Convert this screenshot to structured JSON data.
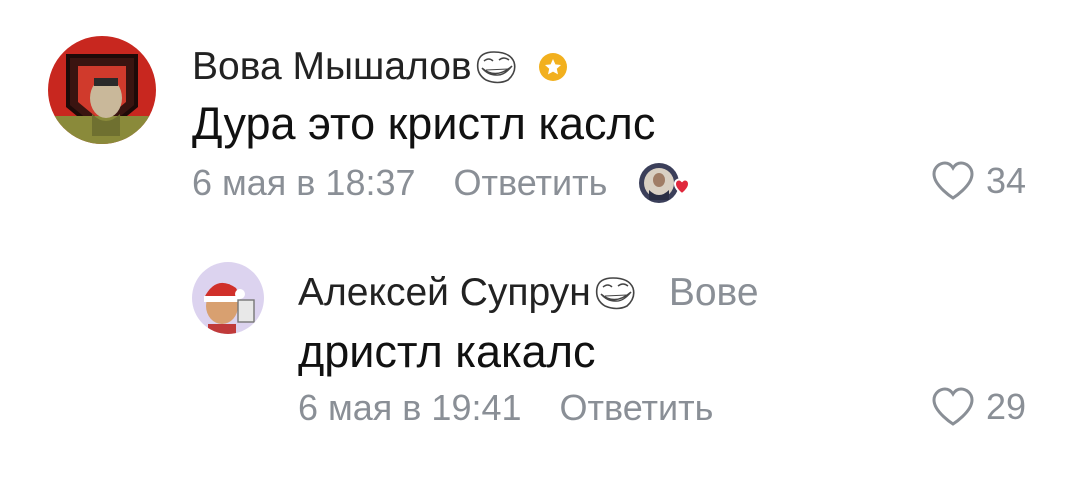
{
  "comments": [
    {
      "author": "Вова Мышалов",
      "text": "Дура это кристл каслс",
      "date": "6 мая в 18:37",
      "reply_label": "Ответить",
      "likes": "34",
      "badges": [
        "troll-face-icon",
        "verified-star-icon"
      ],
      "liked_by_author": true
    },
    {
      "author": "Алексей Супрун",
      "reply_to": "Вове",
      "text": "дристл какалс",
      "date": "6 мая в 19:41",
      "reply_label": "Ответить",
      "likes": "29",
      "badges": [
        "troll-face-icon"
      ]
    }
  ],
  "colors": {
    "name": "#222222",
    "text": "#111111",
    "meta": "#8a8f96",
    "verified": "#f2b01e",
    "heart_red": "#e0283c"
  }
}
